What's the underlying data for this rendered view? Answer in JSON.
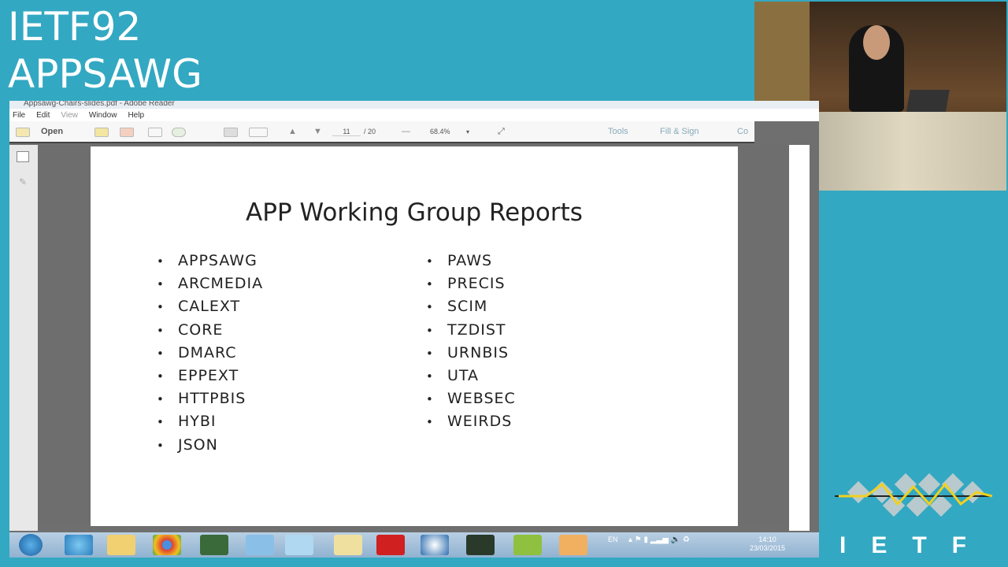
{
  "conference": {
    "line1": "IETF92",
    "line2": "APPSAWG"
  },
  "window": {
    "title": "Appsawg-Chairs-slides.pdf - Adobe Reader"
  },
  "menu": [
    "File",
    "Edit",
    "View",
    "Window",
    "Help"
  ],
  "toolbar": {
    "open": "Open",
    "page_current": "11",
    "page_total": "/ 20",
    "zoom": "68.4%",
    "tools": "Tools",
    "fill_sign": "Fill & Sign",
    "comment": "Co"
  },
  "slide": {
    "title": "APP Working Group Reports",
    "left": [
      "APPSAWG",
      "ARCMEDIA",
      "CALEXT",
      "CORE",
      "DMARC",
      "EPPEXT",
      "HTTPBIS",
      "HYBI",
      "JSON"
    ],
    "right": [
      "PAWS",
      "PRECIS",
      "SCIM",
      "TZDIST",
      "URNBIS",
      "UTA",
      "WEBSEC",
      "WEIRDS"
    ]
  },
  "taskbar": {
    "lang": "EN",
    "time": "14:10",
    "date": "23/03/2015"
  },
  "logo": {
    "text": "IETF"
  }
}
